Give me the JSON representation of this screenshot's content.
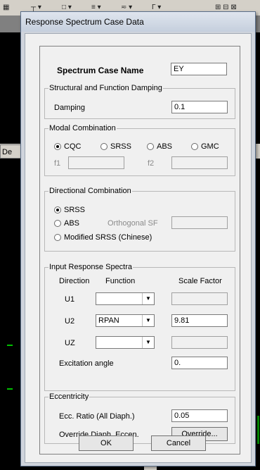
{
  "dialog": {
    "title": "Response Spectrum Case Data",
    "spectrum_case_name_label": "Spectrum Case Name",
    "spectrum_case_name_value": "EY",
    "damping_group": {
      "legend": "Structural and Function Damping",
      "damping_label": "Damping",
      "damping_value": "0.1"
    },
    "modal_group": {
      "legend": "Modal Combination",
      "options": [
        "CQC",
        "SRSS",
        "ABS",
        "GMC"
      ],
      "selected": "CQC",
      "f1_label": "f1",
      "f2_label": "f2",
      "f1_value": "",
      "f2_value": ""
    },
    "directional_group": {
      "legend": "Directional Combination",
      "options": [
        "SRSS",
        "ABS",
        "Modified SRSS (Chinese)"
      ],
      "selected": "SRSS",
      "orthogonal_label": "Orthogonal SF",
      "orthogonal_value": ""
    },
    "spectra_group": {
      "legend": "Input Response Spectra",
      "col_direction": "Direction",
      "col_function": "Function",
      "col_scale": "Scale Factor",
      "rows": [
        {
          "direction": "U1",
          "function": "",
          "scale": ""
        },
        {
          "direction": "U2",
          "function": "RPAN",
          "scale": "9.81"
        },
        {
          "direction": "UZ",
          "function": "",
          "scale": ""
        }
      ],
      "excitation_label": "Excitation  angle",
      "excitation_value": "0."
    },
    "eccentricity_group": {
      "legend": "Eccentricity",
      "ratio_label": "Ecc. Ratio (All Diaph.)",
      "ratio_value": "0.05",
      "override_label": "Override Diaph. Eccen.",
      "override_button": "Override..."
    },
    "ok_button": "OK",
    "cancel_button": "Cancel"
  },
  "background": {
    "side_tab_label": "De"
  },
  "icons": {
    "radio_selected": "radio-selected-icon",
    "dropdown_arrow": "dropdown-arrow-icon"
  }
}
